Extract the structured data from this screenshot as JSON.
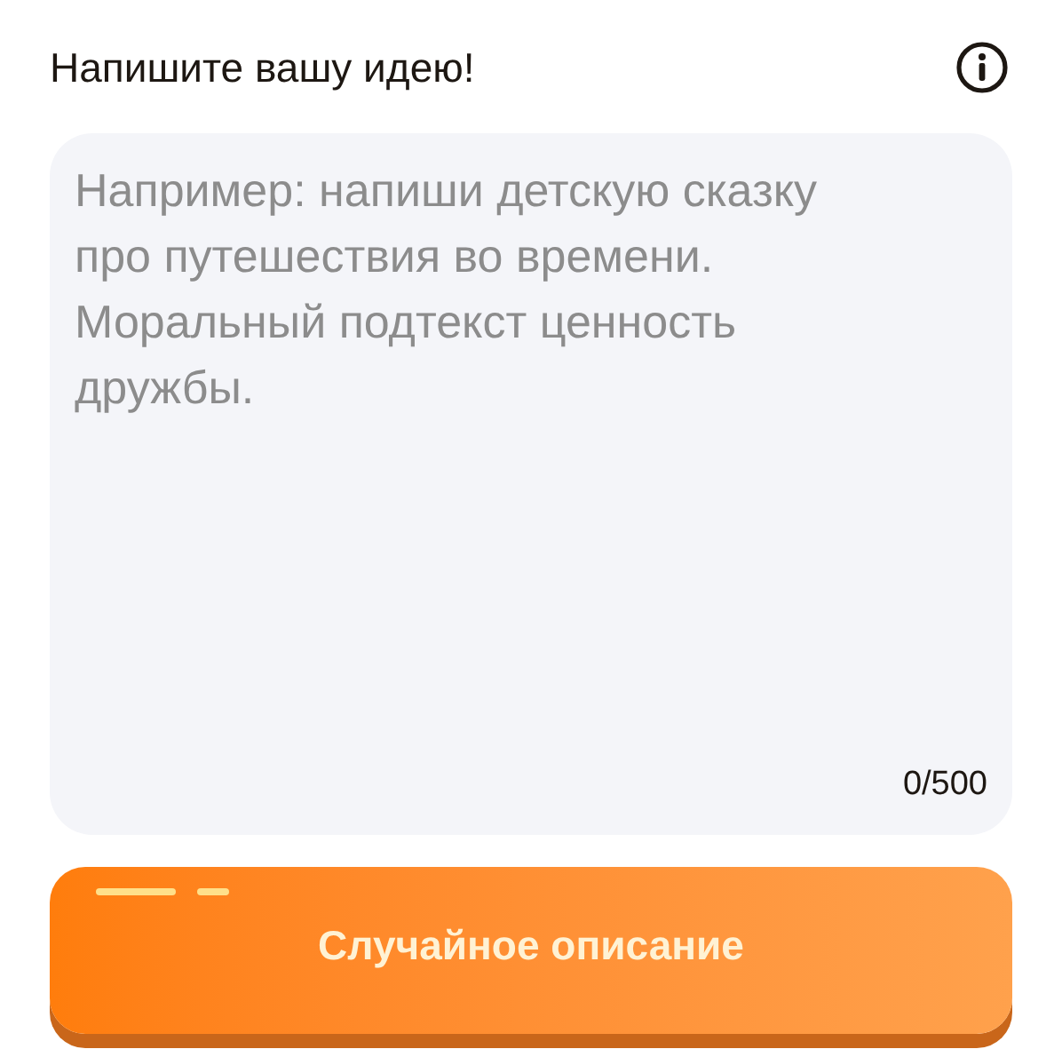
{
  "header": {
    "title": "Напишите вашу идею!"
  },
  "idea_field": {
    "placeholder": "Например: напиши детскую сказку про путешествия во времени. Моральный подтекст ценность дружбы.",
    "counter": "0/500"
  },
  "random_button": {
    "label": "Случайное описание"
  }
}
